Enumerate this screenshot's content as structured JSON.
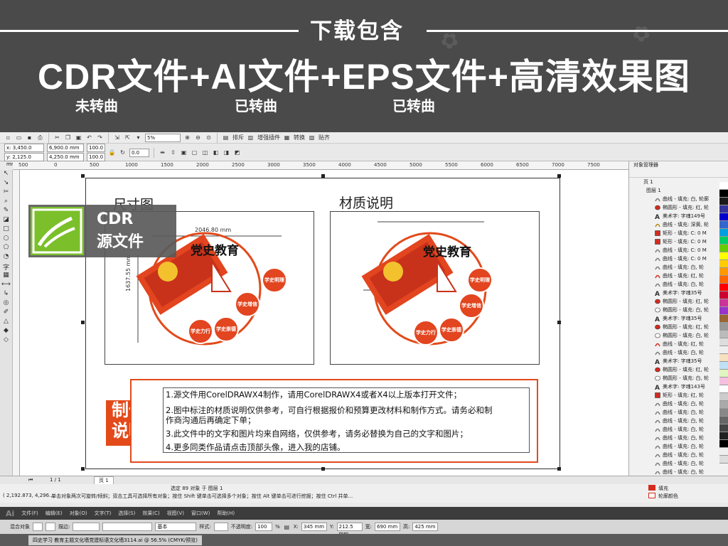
{
  "banner": {
    "subtitle": "下载包含",
    "headline": "CDR文件+AI文件+EPS文件+高清效果图",
    "note_cdr": "未转曲",
    "note_ai": "已转曲",
    "note_eps": "已转曲"
  },
  "cdr_badge": {
    "line1": "CDR",
    "line2": "源文件"
  },
  "toolbar": {
    "zoom_value": "5%",
    "snap_label": "贴齐",
    "arrange_label": "排斥",
    "plugins_label": "增强插件",
    "convert_label": "转换"
  },
  "property_bar": {
    "x": "x: 3,450.0 mm",
    "y": "y: 2,125.0 mm",
    "w": "6,900.0 mm",
    "h": "4,250.0 mm",
    "scale_x": "100.0",
    "scale_y": "100.0",
    "angle": "0.0"
  },
  "ruler_h_ticks": [
    "500",
    "0",
    "500",
    "1000",
    "1500",
    "2000",
    "2500",
    "3000",
    "3500",
    "4000",
    "4500",
    "5000",
    "5500",
    "6000",
    "6500",
    "7000",
    "7500"
  ],
  "page": {
    "size_heading": "尺寸图",
    "material_heading": "材质说明",
    "dim_width": "2046.80 mm",
    "dim_height": "1637.55 mm",
    "make_label_1": "制作",
    "make_label_2": "说明",
    "info_lines": [
      "1.源文件用CorelDRAWX4制作，请用CorelDRAWX4或者X4以上版本打开文件；",
      "2.图中标注的材质说明仅供参考，可自行根据报价和预算更改材料和制作方式。请务必和制",
      "作商沟通后再确定下单；",
      "3.此文件中的文字和图片均来自网络，仅供参考，请务必替换为自己的文字和图片；",
      "4.更多同类作品请点击顶部头像，进入我的店铺。"
    ],
    "artwork": {
      "title": "党史教育",
      "circle_1": "学史明理",
      "circle_2": "学史增信",
      "circle_3": "学史崇德",
      "circle_4": "学史力行"
    }
  },
  "docker": {
    "title": "对象管理器",
    "page_label": "页 1",
    "layer_label": "图层 1",
    "items": [
      {
        "label": "曲线 - 填充: 白, 轮廓",
        "icon": "curve-icon",
        "color": "#7a7a7a"
      },
      {
        "label": "椭圆形 - 填充: 红, 轮",
        "icon": "ellipse-icon",
        "color": "#d32c1f"
      },
      {
        "label": "美术字: 字魂149号",
        "icon": "text-icon",
        "color": "#333333"
      },
      {
        "label": "曲线 - 填充: 深黄, 轮",
        "icon": "curve-icon",
        "color": "#b08a1a"
      },
      {
        "label": "矩形 - 填充: C: 0 M",
        "icon": "rectangle-icon",
        "color": "#d32c1f"
      },
      {
        "label": "矩形 - 填充: C: 0 M",
        "icon": "rectangle-icon",
        "color": "#d32c1f"
      },
      {
        "label": "曲线 - 填充: C: 0 M",
        "icon": "curve-icon",
        "color": "#7a7a7a"
      },
      {
        "label": "曲线 - 填充: C: 0 M",
        "icon": "curve-icon",
        "color": "#7a7a7a"
      },
      {
        "label": "曲线 - 填充: 白, 轮",
        "icon": "curve-icon",
        "color": "#7a7a7a"
      },
      {
        "label": "曲线 - 填充: 红, 轮",
        "icon": "curve-icon",
        "color": "#d32c1f"
      },
      {
        "label": "曲线 - 填充: 白, 轮",
        "icon": "curve-icon",
        "color": "#7a7a7a"
      },
      {
        "label": "美术字: 字魂35号",
        "icon": "text-icon",
        "color": "#333333"
      },
      {
        "label": "椭圆形 - 填充: 红, 轮",
        "icon": "ellipse-icon",
        "color": "#d32c1f"
      },
      {
        "label": "椭圆形 - 填充: 白, 轮",
        "icon": "ellipse-icon",
        "color": "#ffffff"
      },
      {
        "label": "美术字: 字魂35号",
        "icon": "text-icon",
        "color": "#333333"
      },
      {
        "label": "椭圆形 - 填充: 红, 轮",
        "icon": "ellipse-icon",
        "color": "#d32c1f"
      },
      {
        "label": "椭圆形 - 填充: 白, 轮",
        "icon": "ellipse-icon",
        "color": "#ffffff"
      },
      {
        "label": "曲线 - 填充: 红, 轮",
        "icon": "curve-icon",
        "color": "#d32c1f"
      },
      {
        "label": "曲线 - 填充: 白, 轮",
        "icon": "curve-icon",
        "color": "#7a7a7a"
      },
      {
        "label": "美术字: 字魂35号",
        "icon": "text-icon",
        "color": "#333333"
      },
      {
        "label": "椭圆形 - 填充: 红, 轮",
        "icon": "ellipse-icon",
        "color": "#d32c1f"
      },
      {
        "label": "椭圆形 - 填充: 白, 轮",
        "icon": "ellipse-icon",
        "color": "#ffffff"
      },
      {
        "label": "美术字: 字魂143号",
        "icon": "text-icon",
        "color": "#333333"
      },
      {
        "label": "矩形 - 填充: 红, 轮",
        "icon": "rectangle-icon",
        "color": "#d32c1f"
      },
      {
        "label": "曲线 - 填充: 白, 轮",
        "icon": "curve-icon",
        "color": "#7a7a7a"
      },
      {
        "label": "曲线 - 填充: 白, 轮",
        "icon": "curve-icon",
        "color": "#7a7a7a"
      },
      {
        "label": "曲线 - 填充: 白, 轮",
        "icon": "curve-icon",
        "color": "#7a7a7a"
      },
      {
        "label": "曲线 - 填充: 白, 轮",
        "icon": "curve-icon",
        "color": "#7a7a7a"
      },
      {
        "label": "曲线 - 填充: 白, 轮",
        "icon": "curve-icon",
        "color": "#7a7a7a"
      },
      {
        "label": "曲线 - 填充: 白, 轮",
        "icon": "curve-icon",
        "color": "#7a7a7a"
      },
      {
        "label": "曲线 - 填充: 白, 轮",
        "icon": "curve-icon",
        "color": "#7a7a7a"
      },
      {
        "label": "曲线 - 填充: 白, 轮",
        "icon": "curve-icon",
        "color": "#7a7a7a"
      },
      {
        "label": "曲线 - 填充: 白, 轮",
        "icon": "curve-icon",
        "color": "#7a7a7a"
      },
      {
        "label": "曲线 - 填充: 白, 轮",
        "icon": "curve-icon",
        "color": "#7a7a7a"
      }
    ]
  },
  "palette_colors": [
    "#ffffff",
    "#000000",
    "#1a1a1a",
    "#333399",
    "#0000cc",
    "#3366cc",
    "#00a0e0",
    "#00cc66",
    "#66cc00",
    "#ffff00",
    "#ffcc00",
    "#ff9900",
    "#ff6600",
    "#ff0000",
    "#cc0033",
    "#cc3399",
    "#9933cc",
    "#996633",
    "#999999",
    "#bbbbbb",
    "#dddddd",
    "#eeeeee",
    "#f5e0c0",
    "#c0e0f5",
    "#e0f5c0",
    "#f5c0e0",
    "#ffffff",
    "#cccccc",
    "#aaaaaa",
    "#888888",
    "#666666",
    "#444444",
    "#222222",
    "#000000",
    "#eeeeee",
    "#dddddd"
  ],
  "page_nav": {
    "counter": "1 / 1",
    "tab": "页 1"
  },
  "status": {
    "selection": "选定 89 对象 于 图层 1",
    "coords": "( 2,192.873, 4,296....",
    "hint": "单击对象两次可旋转/倾斜；双击工具可选择所有对象；按住 Shift 键单击可选择多个对象；按住 Alt 键单击可进行挖掘；按住 Ctrl 并单...",
    "fill_label": "填充",
    "outline_label": "轮廓颜色"
  },
  "ai_menu": [
    "Ai",
    "文件(F)",
    "编辑(E)",
    "对象(O)",
    "文字(T)",
    "选择(S)",
    "效果(C)",
    "视图(V)",
    "窗口(W)",
    "帮助(H)"
  ],
  "ai_control": {
    "mixed": "混合对象",
    "stroke_label": "描边:",
    "basic": "基本",
    "style_label": "样式:",
    "opacity_label": "不透明度:",
    "opacity": "100",
    "opacity_unit": "%",
    "x_label": "X:",
    "x": "345 mm",
    "y_label": "Y:",
    "y": "212.5 mm",
    "w_label": "宽:",
    "w": "690 mm",
    "h_label": "高:",
    "h": "425 mm"
  },
  "ai_tab": "四史学习 教育主题文化墙党建标语文化墙3114.ai @ 56.5% (CMYK/预览)"
}
